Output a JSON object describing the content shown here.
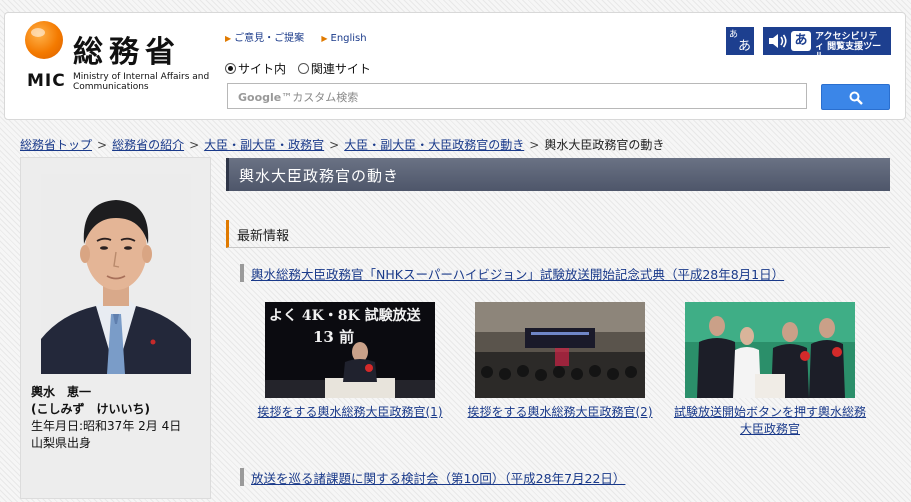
{
  "header": {
    "logo_jp": "総務省",
    "logo_mic": "MIC",
    "logo_en": "Ministry of Internal Affairs and Communications",
    "links": [
      "ご意見・ご提案",
      "English"
    ],
    "font_size_button": "あ\nあ",
    "accessibility_label": "アクセシビリティ 閲覧支援ツール",
    "accessibility_char": "あ",
    "radio_options": [
      {
        "label": "サイト内",
        "selected": true
      },
      {
        "label": "関連サイト",
        "selected": false
      }
    ],
    "search_placeholder": "Google™カスタム検索",
    "search_brand": "Google",
    "search_suffix": "™カスタム検索"
  },
  "breadcrumb": {
    "items": [
      "総務省トップ",
      "総務省の紹介",
      "大臣・副大臣・政務官",
      "大臣・副大臣・大臣政務官の動き"
    ],
    "current": "輿水大臣政務官の動き",
    "separator": ">"
  },
  "profile": {
    "name": "輿水　恵一",
    "reading": "(こしみず　けいいち)",
    "birth": "生年月日:昭和37年 2月 4日",
    "origin": "山梨県出身"
  },
  "main": {
    "page_title": "輿水大臣政務官の動き",
    "section_title": "最新情報",
    "news": [
      "輿水総務大臣政務官「NHKスーパーハイビジョン」試験放送開始記念式典（平成28年8月1日）",
      "放送を巡る諸課題に関する検討会（第10回）（平成28年7月22日）"
    ],
    "thumbs": [
      {
        "caption_lines": [
          "挨拶をする輿水総務大臣政務官(1)"
        ],
        "screen_text_1": "よく 4K・8K 試験放送",
        "screen_text_2": "13 前"
      },
      {
        "caption_lines": [
          "挨拶をする輿水総務大臣政務官(2)"
        ]
      },
      {
        "caption_lines": [
          "試験放送開始ボタンを押す輿水総務",
          "大臣政務官"
        ]
      }
    ]
  },
  "colors": {
    "title_bar": "#5a6276",
    "section_accent": "#e07a00",
    "search_button": "#3b86e8",
    "link": "#1a3a8a"
  }
}
